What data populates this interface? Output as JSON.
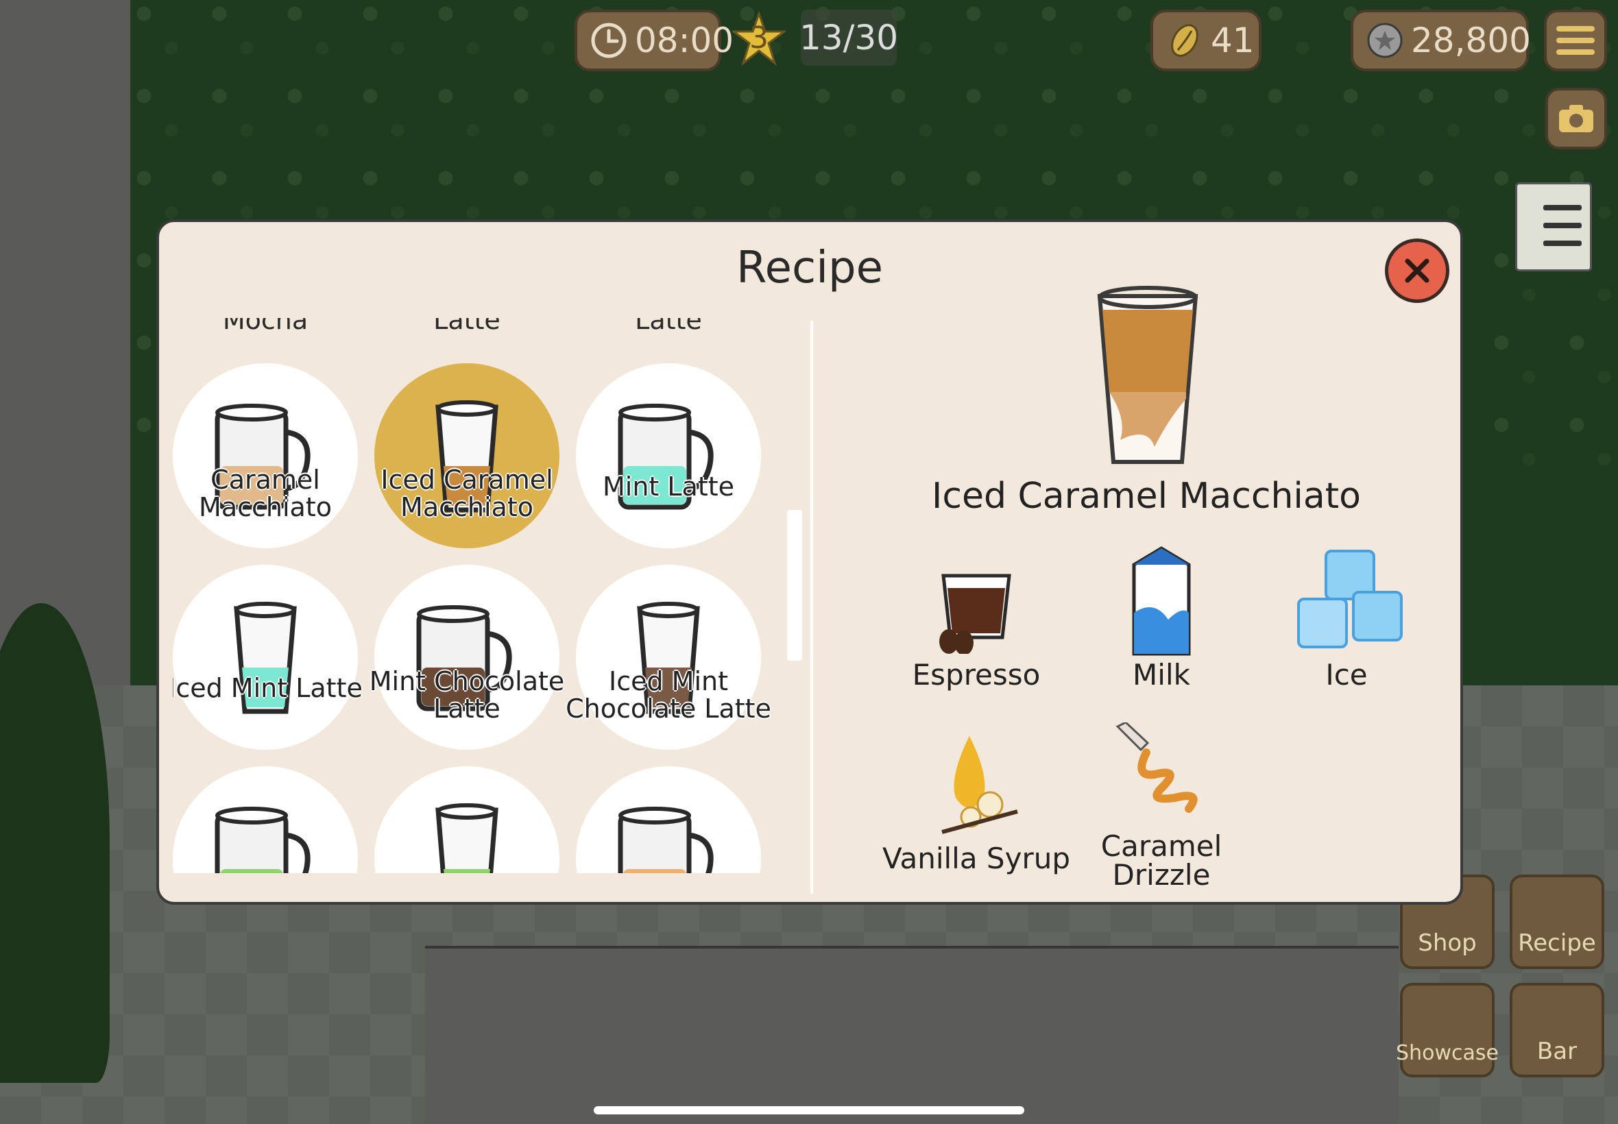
{
  "hud": {
    "time": "08:00",
    "level": "3",
    "stars": "13/30",
    "beans": "41",
    "coins": "28,800"
  },
  "side_buttons": {
    "shop": "Shop",
    "recipe": "Recipe",
    "showcase": "Showcase",
    "bar": "Bar"
  },
  "modal": {
    "title": "Recipe",
    "cut_labels": [
      "Mocha",
      "Latte",
      "Latte"
    ],
    "recipes": [
      {
        "label": "Caramel Macchiato",
        "cup": "mug",
        "fill": "#e2b98a",
        "selected": false
      },
      {
        "label": "Iced Caramel Macchiato",
        "cup": "glass",
        "fill": "#c98a3e",
        "selected": true
      },
      {
        "label": "Mint Latte",
        "cup": "mug",
        "fill": "#7de8d2",
        "selected": false
      },
      {
        "label": "Iced Mint Latte",
        "cup": "glass",
        "fill": "#7de8d2",
        "selected": false
      },
      {
        "label": "Mint Chocolate Latte",
        "cup": "mug",
        "fill": "#6b4a35",
        "selected": false
      },
      {
        "label": "Iced Mint Chocolate Latte",
        "cup": "glass",
        "fill": "#7a5a45",
        "selected": false
      },
      {
        "label": "",
        "cup": "mug",
        "fill": "#8fd36b",
        "selected": false
      },
      {
        "label": "",
        "cup": "glass",
        "fill": "#8fd36b",
        "selected": false
      },
      {
        "label": "",
        "cup": "mug",
        "fill": "#f0b070",
        "selected": false
      }
    ],
    "detail": {
      "name": "Iced Caramel Macchiato",
      "ingredients": [
        "Espresso",
        "Milk",
        "Ice",
        "Vanilla Syrup",
        "Caramel Drizzle"
      ]
    }
  }
}
